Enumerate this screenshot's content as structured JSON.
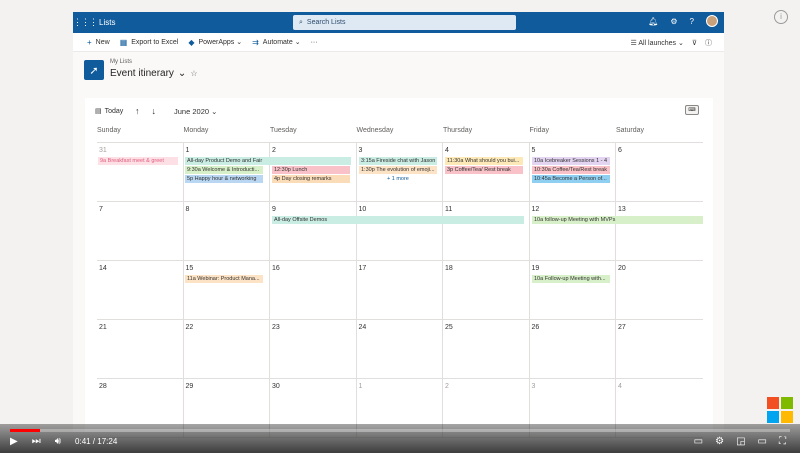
{
  "app": {
    "name": "Lists",
    "search_placeholder": "Search Lists"
  },
  "commands": {
    "new": "New",
    "export": "Export to Excel",
    "powerapps": "PowerApps",
    "automate": "Automate",
    "more": "···",
    "view": "All launches"
  },
  "list": {
    "breadcrumb": "My Lists",
    "title": "Event itinerary"
  },
  "calendar": {
    "today": "Today",
    "month": "June 2020",
    "days": [
      "Sunday",
      "Monday",
      "Tuesday",
      "Wednesday",
      "Thursday",
      "Friday",
      "Saturday"
    ],
    "weeks": [
      [
        "31",
        "1",
        "2",
        "3",
        "4",
        "5",
        "6"
      ],
      [
        "7",
        "8",
        "9",
        "10",
        "11",
        "12",
        "13"
      ],
      [
        "14",
        "15",
        "16",
        "17",
        "18",
        "19",
        "20"
      ],
      [
        "21",
        "22",
        "23",
        "24",
        "25",
        "26",
        "27"
      ],
      [
        "28",
        "29",
        "30",
        "1",
        "2",
        "3",
        "4"
      ]
    ],
    "events": {
      "e1": "9a Breakfast meet & greet",
      "e2": "All-day Product Demo and Fair",
      "e3": "9:30a Welcome & Introducti...",
      "e4": "5p Happy hour & networking",
      "e5": "12:30p Lunch",
      "e6": "4p Day closing remarks",
      "e7": "3:15a Fireside chat with Jason",
      "e8": "1:30p The evolution of emoji...",
      "e9": "+ 1 more",
      "e10": "11:30a What should you bui...",
      "e11": "3p Coffee/Tea/ Rest break",
      "e12": "10a Icebreaker Sessions 1 - 4",
      "e13": "10:30a Coffee/Tea/Rest break",
      "e14": "10:45a Become a Person of...",
      "e15": "All-day Offsite Demos",
      "e16": "10a follow-up Meeting with MVPs",
      "e17": "11a Webinar: Product Mana...",
      "e18": "10a Follow-up Meeting with..."
    }
  },
  "video": {
    "time": "0:41 / 17:24",
    "progress": 0.039
  },
  "colors": {
    "brand": "#0f5b9b"
  }
}
